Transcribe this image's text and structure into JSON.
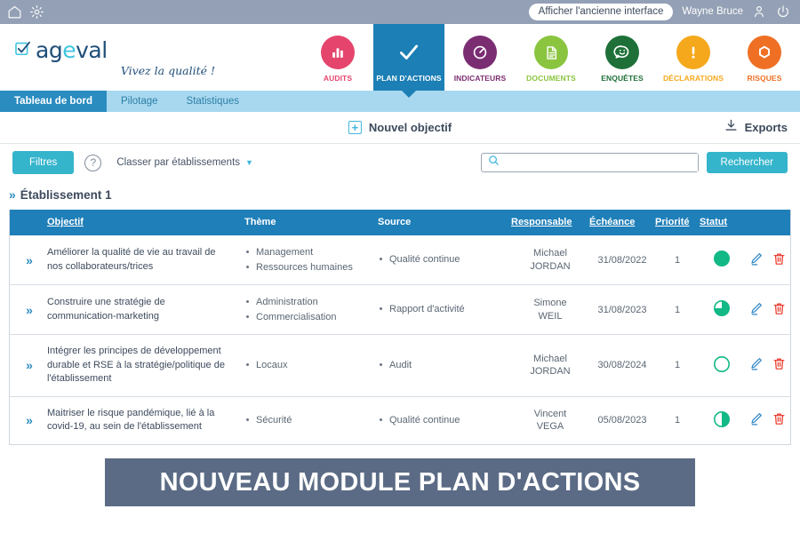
{
  "topbar": {
    "home_icon": "home-icon",
    "settings_icon": "gear-icon",
    "old_interface_button": "Afficher l'ancienne interface",
    "username": "Wayne Bruce",
    "user_icon": "user-icon",
    "power_icon": "power-icon"
  },
  "brand": {
    "name_part1": "ag",
    "name_part2": "e",
    "name_part3": "val",
    "tagline": "Vivez la qualité !",
    "check_icon": "checkbox-check-icon"
  },
  "modules": [
    {
      "label": "AUDITS",
      "icon": "bar-chart-icon",
      "color": "#e5456d",
      "active": false
    },
    {
      "label": "PLAN D'ACTIONS",
      "icon": "check-icon",
      "color": "#1c7fb5",
      "active": true
    },
    {
      "label": "INDICATEURS",
      "icon": "gauge-icon",
      "color": "#7b2d72",
      "active": false
    },
    {
      "label": "DOCUMENTS",
      "icon": "document-icon",
      "color": "#8bc540",
      "active": false
    },
    {
      "label": "ENQUÊTES",
      "icon": "smiley-chat-icon",
      "color": "#1e7038",
      "active": false
    },
    {
      "label": "DÉCLARATIONS",
      "icon": "exclamation-icon",
      "color": "#f5a81c",
      "active": false
    },
    {
      "label": "RISQUES",
      "icon": "hexagon-icon",
      "color": "#ef7024",
      "active": false
    }
  ],
  "subtabs": [
    {
      "label": "Tableau de bord",
      "active": true
    },
    {
      "label": "Pilotage",
      "active": false
    },
    {
      "label": "Statistiques",
      "active": false
    }
  ],
  "actionbar": {
    "new_objective": "Nouvel objectif",
    "new_objective_icon": "plus-box-icon",
    "exports": "Exports",
    "exports_icon": "download-icon"
  },
  "filterbar": {
    "filters_button": "Filtres",
    "help_icon": "question-mark-icon",
    "group_by": "Classer par établissements",
    "group_by_caret": "chevron-down-icon",
    "search_value": "",
    "search_placeholder": "",
    "search_icon": "search-icon",
    "search_button": "Rechercher"
  },
  "establishment": {
    "chevron": "double-chevron-right-icon",
    "name": "Établissement 1"
  },
  "table": {
    "columns": [
      {
        "key": "expand",
        "label": "",
        "sortable": false
      },
      {
        "key": "objectif",
        "label": "Objectif",
        "sortable": true
      },
      {
        "key": "theme",
        "label": "Thème",
        "sortable": false
      },
      {
        "key": "source",
        "label": "Source",
        "sortable": false
      },
      {
        "key": "responsable",
        "label": "Responsable",
        "sortable": true
      },
      {
        "key": "echeance",
        "label": "Échéance",
        "sortable": true
      },
      {
        "key": "priorite",
        "label": "Priorité",
        "sortable": true
      },
      {
        "key": "statut",
        "label": "Statut",
        "sortable": true
      },
      {
        "key": "actions",
        "label": "",
        "sortable": false
      }
    ],
    "rows": [
      {
        "objectif": "Améliorer la qualité de vie au travail de nos collaborateurs/trices",
        "themes": [
          "Management",
          "Ressources humaines"
        ],
        "sources": [
          "Qualité continue"
        ],
        "responsable_first": "Michael",
        "responsable_last": "JORDAN",
        "echeance": "31/08/2022",
        "priorite": "1",
        "statut_percent": 100,
        "statut_color": "#12b886",
        "edit_icon": "pencil-edit-icon",
        "delete_icon": "trash-delete-icon"
      },
      {
        "objectif": "Construire une stratégie de communication-marketing",
        "themes": [
          "Administration",
          "Commercialisation"
        ],
        "sources": [
          "Rapport d'activité"
        ],
        "responsable_first": "Simone",
        "responsable_last": "WEIL",
        "echeance": "31/08/2023",
        "priorite": "1",
        "statut_percent": 75,
        "statut_color": "#12b886",
        "edit_icon": "pencil-edit-icon",
        "delete_icon": "trash-delete-icon"
      },
      {
        "objectif": "Intégrer les principes de développement durable et RSE à la stratégie/politique de l'établissement",
        "themes": [
          "Locaux"
        ],
        "sources": [
          "Audit"
        ],
        "responsable_first": "Michael",
        "responsable_last": "JORDAN",
        "echeance": "30/08/2024",
        "priorite": "1",
        "statut_percent": 0,
        "statut_color": "#12b886",
        "edit_icon": "pencil-edit-icon",
        "delete_icon": "trash-delete-icon"
      },
      {
        "objectif": "Maitriser le risque pandémique, lié à la covid-19, au sein de l'établissement",
        "themes": [
          "Sécurité"
        ],
        "sources": [
          "Qualité continue"
        ],
        "responsable_first": "Vincent",
        "responsable_last": "VEGA",
        "echeance": "05/08/2023",
        "priorite": "1",
        "statut_percent": 50,
        "statut_color": "#12b886",
        "edit_icon": "pencil-edit-icon",
        "delete_icon": "trash-delete-icon"
      }
    ]
  },
  "banner": {
    "text": "NOUVEAU MODULE PLAN D'ACTIONS",
    "background": "#5b6b85"
  }
}
